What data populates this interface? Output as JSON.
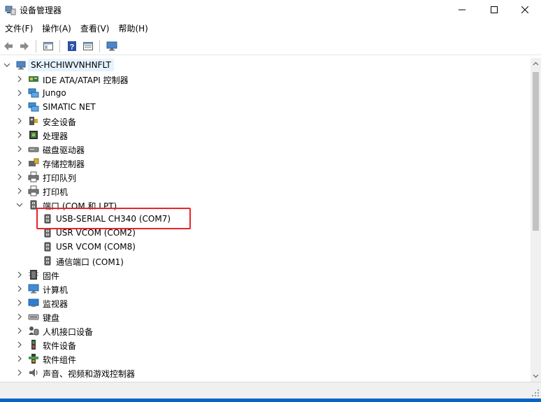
{
  "window": {
    "title": "设备管理器",
    "controls": {
      "minimize": "minimize-icon",
      "maximize": "maximize-icon",
      "close": "close-icon"
    }
  },
  "menu": [
    {
      "label": "文件(F)"
    },
    {
      "label": "操作(A)"
    },
    {
      "label": "查看(V)"
    },
    {
      "label": "帮助(H)"
    }
  ],
  "toolbar": [
    "back-icon",
    "forward-icon",
    "properties-icon",
    "help-icon",
    "view-icon",
    "monitor-icon"
  ],
  "tree": {
    "root": "SK-HCHIWVNHNFLT",
    "items": [
      {
        "label": "IDE ATA/ATAPI 控制器",
        "icon": "ide-controller-icon"
      },
      {
        "label": "Jungo",
        "icon": "network-icon"
      },
      {
        "label": "SIMATIC NET",
        "icon": "network-icon"
      },
      {
        "label": "安全设备",
        "icon": "security-icon"
      },
      {
        "label": "处理器",
        "icon": "processor-icon"
      },
      {
        "label": "磁盘驱动器",
        "icon": "disk-icon"
      },
      {
        "label": "存储控制器",
        "icon": "storage-controller-icon"
      },
      {
        "label": "打印队列",
        "icon": "printer-icon"
      },
      {
        "label": "打印机",
        "icon": "printer-icon"
      },
      {
        "label": "端口 (COM 和 LPT)",
        "icon": "port-icon",
        "expanded": true,
        "children": [
          {
            "label": "USB-SERIAL CH340 (COM7)",
            "icon": "port-icon"
          },
          {
            "label": "USR VCOM (COM2)",
            "icon": "port-icon"
          },
          {
            "label": "USR VCOM (COM8)",
            "icon": "port-icon"
          },
          {
            "label": "通信端口 (COM1)",
            "icon": "port-icon"
          }
        ]
      },
      {
        "label": "固件",
        "icon": "firmware-icon"
      },
      {
        "label": "计算机",
        "icon": "computer-icon"
      },
      {
        "label": "监视器",
        "icon": "monitor-icon"
      },
      {
        "label": "键盘",
        "icon": "keyboard-icon"
      },
      {
        "label": "人机接口设备",
        "icon": "hid-icon"
      },
      {
        "label": "软件设备",
        "icon": "software-device-icon"
      },
      {
        "label": "软件组件",
        "icon": "software-component-icon"
      },
      {
        "label": "声音、视频和游戏控制器",
        "icon": "sound-icon"
      }
    ]
  },
  "colors": {
    "highlight_box": "#e8242a",
    "selection": "#e5f3ff",
    "accent": "#0a64c8"
  }
}
